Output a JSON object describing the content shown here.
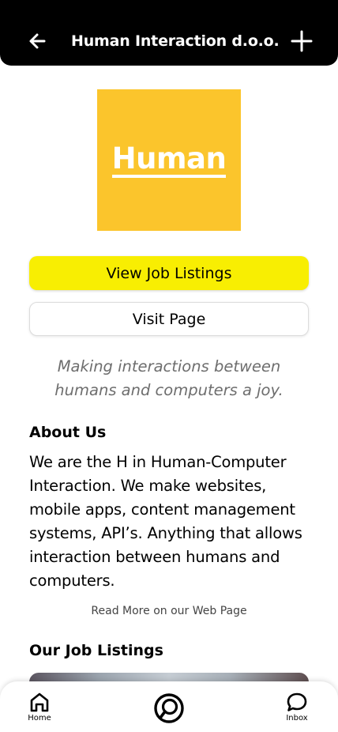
{
  "header": {
    "title": "Human Interaction d.o.o.",
    "back_icon": "arrow-left-icon",
    "add_icon": "plus-icon"
  },
  "logo": {
    "text": "Human",
    "color": "#fbc52c"
  },
  "buttons": {
    "view_jobs": "View Job Listings",
    "visit_page": "Visit Page",
    "primary_color": "#f8ee02"
  },
  "tagline": "Making interactions between humans and computers a joy.",
  "about": {
    "heading": "About Us",
    "body": "We are the H in Human-Computer Interaction. We make websites, mobile apps, content management systems, API’s. Anything that allows interaction between humans and computers."
  },
  "read_more": "Read More on our Web Page",
  "jobs": {
    "heading": "Our Job Listings"
  },
  "tabbar": {
    "home": "Home",
    "inbox": "Inbox",
    "center_icon": "app-logo-icon"
  }
}
